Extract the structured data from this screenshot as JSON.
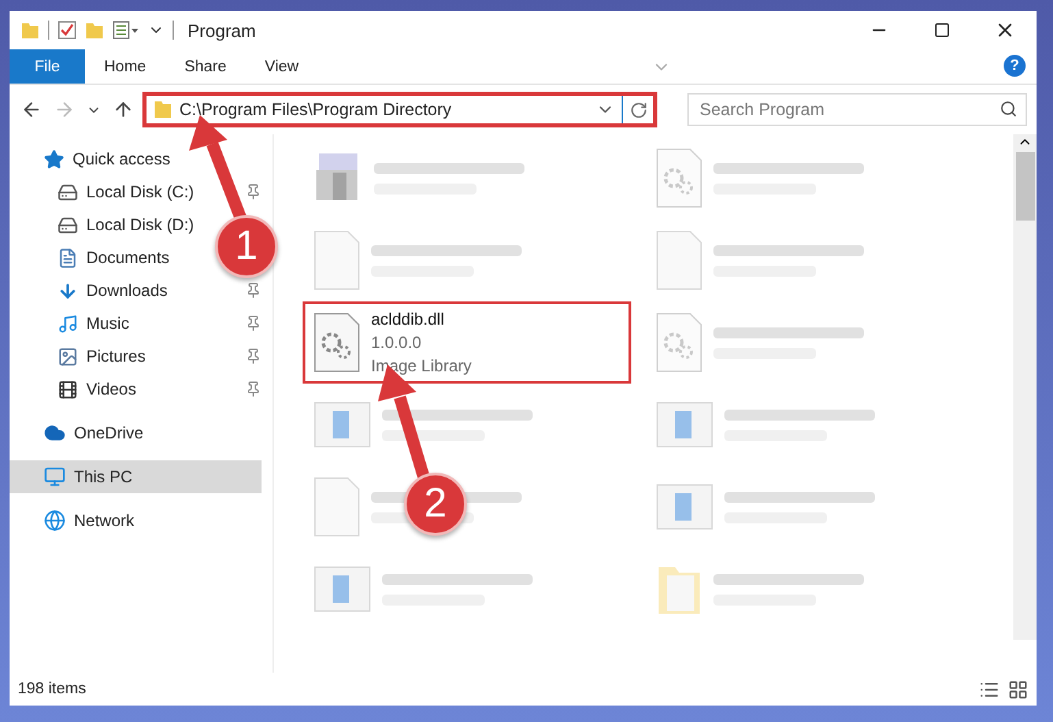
{
  "window": {
    "title": "Program"
  },
  "ribbon_tabs": [
    {
      "label": "File",
      "selected": true
    },
    {
      "label": "Home",
      "selected": false
    },
    {
      "label": "Share",
      "selected": false
    },
    {
      "label": "View",
      "selected": false
    }
  ],
  "help": "?",
  "address": {
    "path": "C:\\Program Files\\Program Directory",
    "highlighted": true
  },
  "search": {
    "placeholder": "Search Program"
  },
  "sidebar": {
    "items": [
      {
        "label": "Quick access",
        "kind": "quick",
        "pinned": false,
        "selected": false
      },
      {
        "label": "Local Disk (C:)",
        "kind": "disk",
        "pinned": true,
        "selected": false
      },
      {
        "label": "Local Disk (D:)",
        "kind": "disk",
        "pinned": false,
        "selected": false
      },
      {
        "label": "Documents",
        "kind": "documents",
        "pinned": false,
        "selected": false
      },
      {
        "label": "Downloads",
        "kind": "downloads",
        "pinned": true,
        "selected": false
      },
      {
        "label": "Music",
        "kind": "music",
        "pinned": true,
        "selected": false
      },
      {
        "label": "Pictures",
        "kind": "pictures",
        "pinned": true,
        "selected": false
      },
      {
        "label": "Videos",
        "kind": "videos",
        "pinned": true,
        "selected": false
      },
      {
        "label": "OneDrive",
        "kind": "cloud",
        "pinned": false,
        "selected": false
      },
      {
        "label": "This PC",
        "kind": "pc",
        "pinned": false,
        "selected": true
      },
      {
        "label": "Network",
        "kind": "network",
        "pinned": false,
        "selected": false
      }
    ]
  },
  "files": [
    {
      "kind": "program",
      "blurred": true,
      "highlighted": false
    },
    {
      "kind": "gear",
      "blurred": true,
      "highlighted": false
    },
    {
      "kind": "blank",
      "blurred": true,
      "highlighted": false
    },
    {
      "kind": "blank",
      "blurred": true,
      "highlighted": false
    },
    {
      "kind": "gear",
      "blurred": false,
      "highlighted": true,
      "name": "aclddib.dll",
      "lines": [
        "1.0.0.0",
        "Image Library"
      ]
    },
    {
      "kind": "gear",
      "blurred": true,
      "highlighted": false
    },
    {
      "kind": "app",
      "blurred": true,
      "highlighted": false
    },
    {
      "kind": "app",
      "blurred": true,
      "highlighted": false
    },
    {
      "kind": "blank",
      "blurred": true,
      "highlighted": false
    },
    {
      "kind": "app",
      "blurred": true,
      "highlighted": false
    },
    {
      "kind": "app",
      "blurred": true,
      "highlighted": false
    },
    {
      "kind": "folder",
      "blurred": true,
      "highlighted": false
    }
  ],
  "status_bar": {
    "count": "198 items"
  },
  "annotations": [
    {
      "label": "1"
    },
    {
      "label": "2"
    }
  ]
}
